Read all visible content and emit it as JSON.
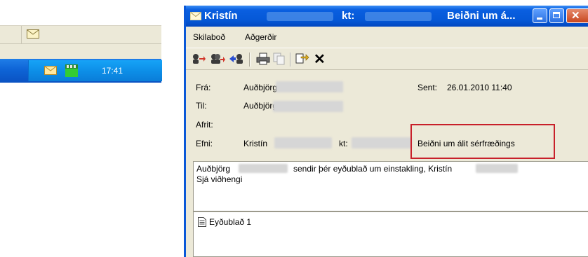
{
  "tray": {
    "time": "17:41"
  },
  "window": {
    "title_name": "Kristín",
    "title_kt": "kt:",
    "title_subject": "Beiðni um á...",
    "close_glyph": "✕"
  },
  "menu": {
    "items": [
      "Skilaboð",
      "Aðgerðir"
    ]
  },
  "toolbar": {
    "delete_glyph": "✕"
  },
  "header": {
    "from_label": "Frá:",
    "from_value": "Auðbjörg",
    "to_label": "Til:",
    "to_value": "Auðbjörg",
    "cc_label": "Afrit:",
    "subject_label": "Efni:",
    "subject_name": "Kristín",
    "subject_kt": "kt:",
    "subject_value": "Beiðni um álit sérfræðings",
    "sent_label": "Sent:",
    "sent_value": "26.01.2010 11:40"
  },
  "body": {
    "line1_a": "Auðbjörg",
    "line1_b": "sendir þér eyðublað um einstakling, Kristín",
    "line2": "Sjá viðhengi"
  },
  "attachment": {
    "name": "Eyðublað 1"
  },
  "colors": {
    "title_blue": "#0558d6",
    "highlight_red": "#c8202a",
    "window_bg": "#ece9d8"
  }
}
